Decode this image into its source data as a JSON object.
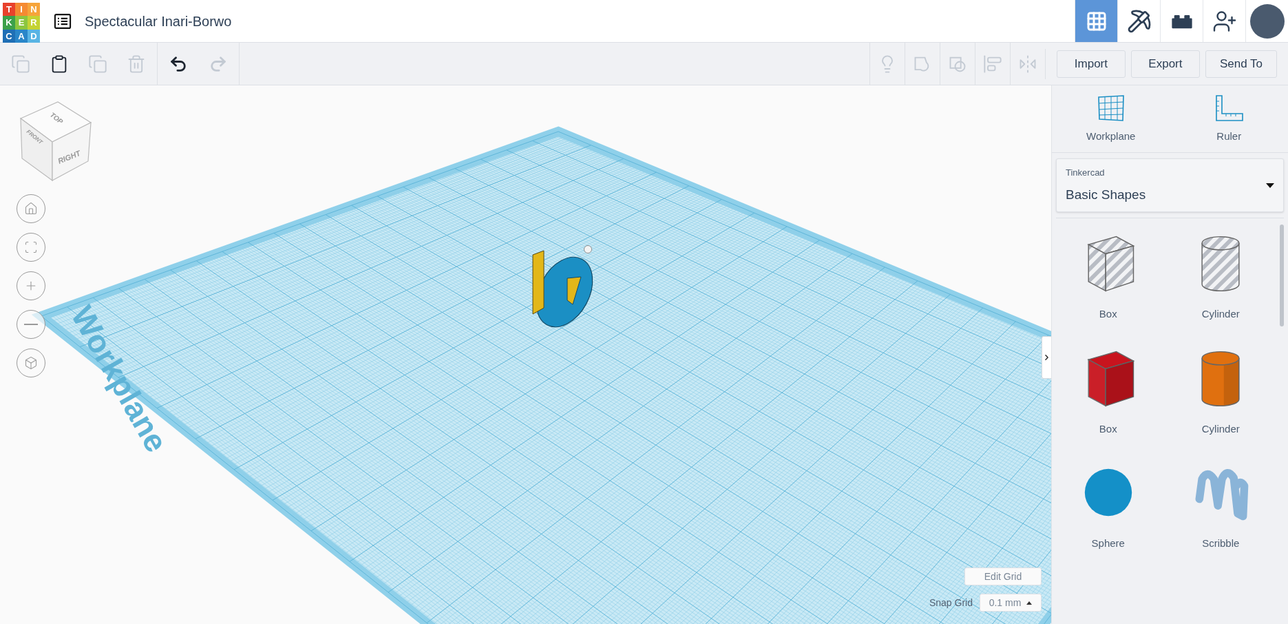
{
  "header": {
    "logo_letters": [
      "T",
      "I",
      "N",
      "K",
      "E",
      "R",
      "C",
      "A",
      "D"
    ],
    "title": "Spectacular Inari-Borwo"
  },
  "nav_tabs": [
    {
      "kind": "grid",
      "selected": true
    },
    {
      "kind": "pickaxe",
      "selected": false
    },
    {
      "kind": "bricks",
      "selected": false
    },
    {
      "kind": "invite",
      "selected": false
    },
    {
      "kind": "avatar",
      "selected": false
    }
  ],
  "toolbar": {
    "edit_tools": [
      {
        "kind": "copy",
        "disabled": true
      },
      {
        "kind": "paste",
        "disabled": false
      },
      {
        "kind": "duplicate",
        "disabled": true
      },
      {
        "kind": "delete",
        "disabled": true
      }
    ],
    "history_tools": [
      {
        "kind": "undo",
        "disabled": false
      },
      {
        "kind": "redo",
        "disabled": true
      }
    ],
    "shape_tools": [
      {
        "kind": "notes",
        "disabled": true
      },
      {
        "kind": "group",
        "disabled": true
      },
      {
        "kind": "ungroup",
        "disabled": true
      },
      {
        "kind": "align",
        "disabled": true
      },
      {
        "kind": "mirror",
        "disabled": true
      }
    ],
    "actions": [
      "Import",
      "Export",
      "Send To"
    ]
  },
  "view_cube": {
    "top": "TOP",
    "front": "FRONT",
    "right": "RIGHT"
  },
  "view_controls": [
    {
      "kind": "home"
    },
    {
      "kind": "fit"
    },
    {
      "kind": "zoom_in"
    },
    {
      "kind": "zoom_out"
    },
    {
      "kind": "perspective"
    }
  ],
  "workplane": {
    "label": "Workplane"
  },
  "grid_controls": {
    "edit_button": "Edit Grid",
    "snap_label": "Snap Grid",
    "snap_value": "0.1 mm"
  },
  "panel": {
    "tools": [
      {
        "kind": "workplane",
        "label": "Workplane"
      },
      {
        "kind": "ruler",
        "label": "Ruler"
      }
    ],
    "library": {
      "source": "Tinkercad",
      "value": "Basic Shapes"
    },
    "shapes": [
      {
        "kind": "box",
        "name": "Box",
        "hole": true,
        "color": "#b8bcc4"
      },
      {
        "kind": "cylinder",
        "name": "Cylinder",
        "hole": true,
        "color": "#b8bcc4"
      },
      {
        "kind": "box",
        "name": "Box",
        "hole": false,
        "color": "#c8141e"
      },
      {
        "kind": "cylinder",
        "name": "Cylinder",
        "hole": false,
        "color": "#e0700f"
      },
      {
        "kind": "sphere",
        "name": "Sphere",
        "color": "#1490c8"
      },
      {
        "kind": "scribble",
        "name": "Scribble",
        "color": "#8ab4d8"
      }
    ]
  }
}
